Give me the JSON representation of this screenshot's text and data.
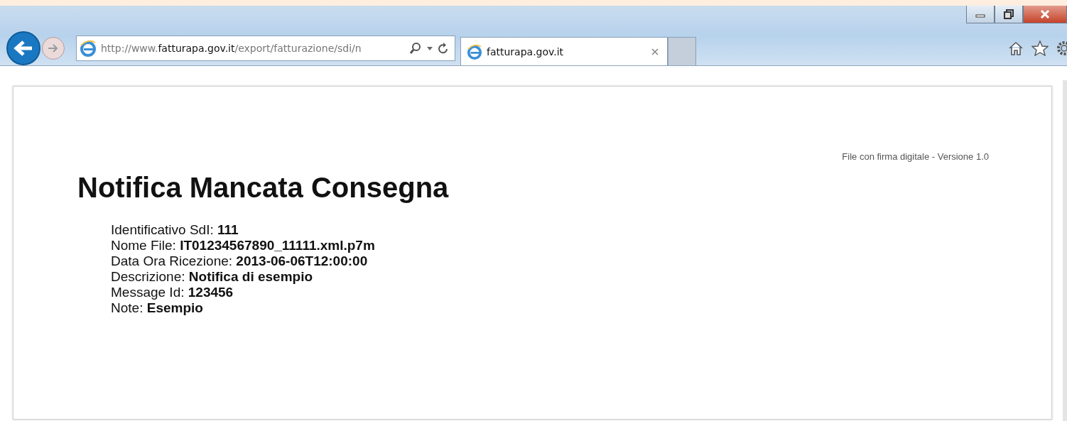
{
  "browser": {
    "address": "http://www.**fatturapa.gov.it**/export/fatturazione/sdi/n",
    "tabs": [
      {
        "label": "fatturapa.gov.it",
        "selected": true
      }
    ]
  },
  "page": {
    "version": "File con firma digitale - Versione 1.0",
    "title": "Notifica Mancata Consegna",
    "fields": [
      "Identificativo SdI: **111**",
      "Nome File: **IT01234567890_11111.xml.p7m**",
      "Data Ora Ricezione: **2013-06-06T12:00:00**",
      "Descrizione: **Notifica di esempio**",
      "Message Id: **123456**",
      "Note: **Esempio**"
    ]
  }
}
